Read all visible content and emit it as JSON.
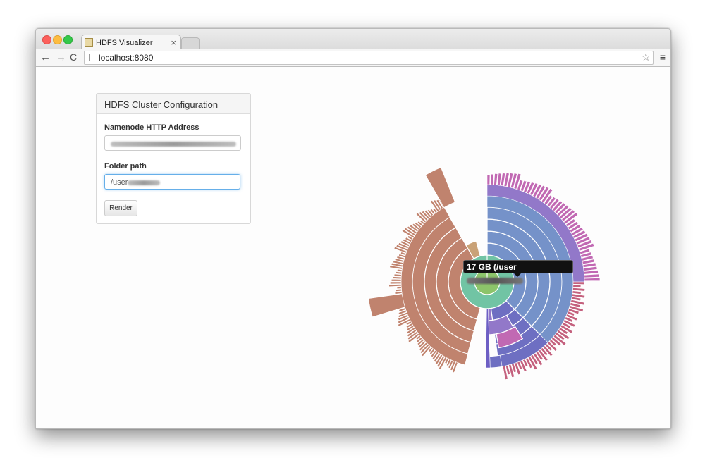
{
  "browser": {
    "tab_title": "HDFS Visualizer",
    "tab_close": "×",
    "url": "localhost:8080",
    "nav": {
      "back": "←",
      "forward": "→",
      "reload": "C"
    },
    "star": "☆",
    "menu": "≡"
  },
  "panel": {
    "title": "HDFS Cluster Configuration",
    "namenode_label": "Namenode HTTP Address",
    "folder_label": "Folder path",
    "folder_value": "/user",
    "render_label": "Render"
  },
  "sunburst": {
    "tooltip_text": "17 GB (/user",
    "colors": {
      "brown": "#c0836e",
      "blue": "#7592c9",
      "indigo": "#6e6fc2",
      "purple": "#9278c9",
      "magenta": "#c169b3",
      "pink": "#c4617e",
      "center": "#8cc46a",
      "ring": "#71c4a4",
      "tan": "#c9a277"
    }
  }
}
